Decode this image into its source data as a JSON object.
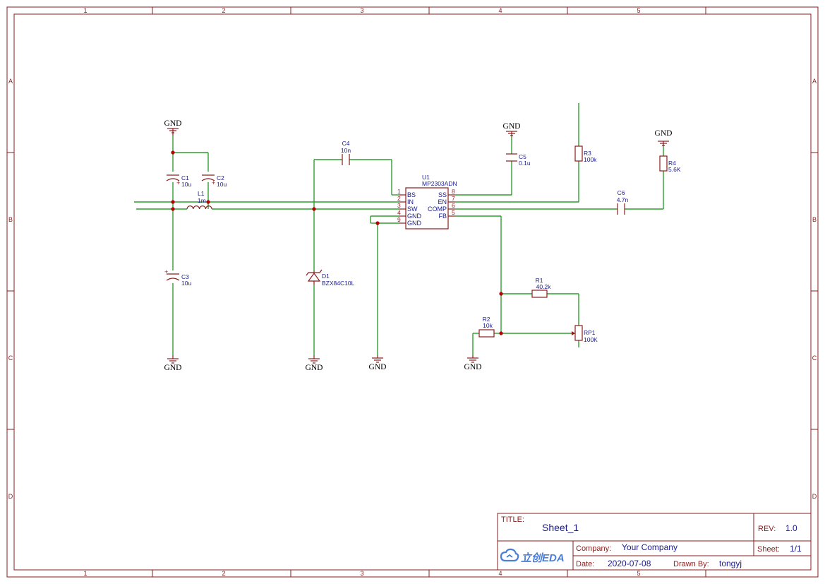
{
  "frame": {
    "columns": [
      "1",
      "2",
      "3",
      "4",
      "5"
    ],
    "rows": [
      "A",
      "B",
      "C",
      "D"
    ]
  },
  "components": {
    "c1": {
      "ref": "C1",
      "value": "10u"
    },
    "c2": {
      "ref": "C2",
      "value": "10u"
    },
    "c3": {
      "ref": "C3",
      "value": "10u"
    },
    "c4": {
      "ref": "C4",
      "value": "10n"
    },
    "c5": {
      "ref": "C5",
      "value": "0.1u"
    },
    "c6": {
      "ref": "C6",
      "value": "4.7n"
    },
    "l1": {
      "ref": "L1",
      "value": "1m"
    },
    "d1": {
      "ref": "D1",
      "value": "BZX84C10L"
    },
    "r1": {
      "ref": "R1",
      "value": "40.2k"
    },
    "r2": {
      "ref": "R2",
      "value": "10k"
    },
    "r3": {
      "ref": "R3",
      "value": "100k"
    },
    "r4": {
      "ref": "R4",
      "value": "5.6K"
    },
    "rp1": {
      "ref": "RP1",
      "value": "100K"
    },
    "u1": {
      "ref": "U1",
      "value": "MP2303ADN",
      "left_pins": [
        {
          "num": "1",
          "name": "BS"
        },
        {
          "num": "2",
          "name": "IN"
        },
        {
          "num": "3",
          "name": "SW"
        },
        {
          "num": "4",
          "name": "GND"
        },
        {
          "num": "9",
          "name": "GND"
        }
      ],
      "right_pins": [
        {
          "num": "8",
          "name": "SS"
        },
        {
          "num": "7",
          "name": "EN"
        },
        {
          "num": "6",
          "name": "COMP"
        },
        {
          "num": "5",
          "name": "FB"
        }
      ]
    }
  },
  "gnd_label": "GND",
  "title_block": {
    "title_label": "TITLE:",
    "title_value": "Sheet_1",
    "rev_label": "REV:",
    "rev_value": "1.0",
    "company_label": "Company:",
    "company_value": "Your Company",
    "sheet_label": "Sheet:",
    "sheet_value": "1/1",
    "date_label": "Date:",
    "date_value": "2020-07-08",
    "drawn_label": "Drawn By:",
    "drawn_value": "tongyj",
    "logo_cn": "立创",
    "logo_en": "EDA"
  },
  "colors": {
    "frame": "#8b1c1c",
    "wire": "#2f9e2f",
    "label": "#1a1a8c",
    "junction": "#b20000",
    "logo": "#4a7ed8"
  }
}
